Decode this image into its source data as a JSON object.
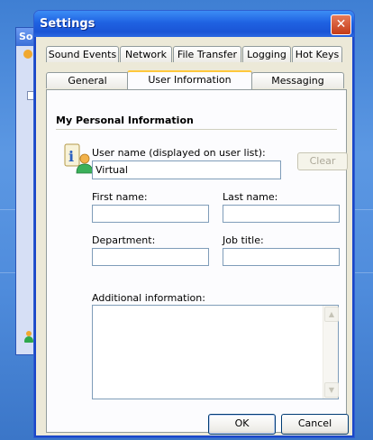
{
  "background_window": {
    "title": "So"
  },
  "dialog": {
    "title": "Settings",
    "close_label": "✕",
    "tabs_back_row": [
      "Sound Events",
      "Network",
      "File Transfer",
      "Logging",
      "Hot Keys"
    ],
    "tabs_front_row": [
      "General",
      "User Information",
      "Messaging"
    ],
    "active_tab": "User Information",
    "section_title": "My Personal Information",
    "username_label": "User name (displayed on user list):",
    "username_value": "Virtual",
    "clear_label": "Clear",
    "first_name_label": "First name:",
    "first_name_value": "",
    "last_name_label": "Last name:",
    "last_name_value": "",
    "department_label": "Department:",
    "department_value": "",
    "job_title_label": "Job title:",
    "job_title_value": "",
    "additional_label": "Additional information:",
    "additional_value": "",
    "ok_label": "OK",
    "cancel_label": "Cancel"
  },
  "colors": {
    "accent": "#1f62e2",
    "tab_highlight": "#ffc83c",
    "close": "#c43c18"
  },
  "icons": [
    "close-icon",
    "user-info-icon",
    "scroll-up-icon",
    "scroll-down-icon"
  ]
}
